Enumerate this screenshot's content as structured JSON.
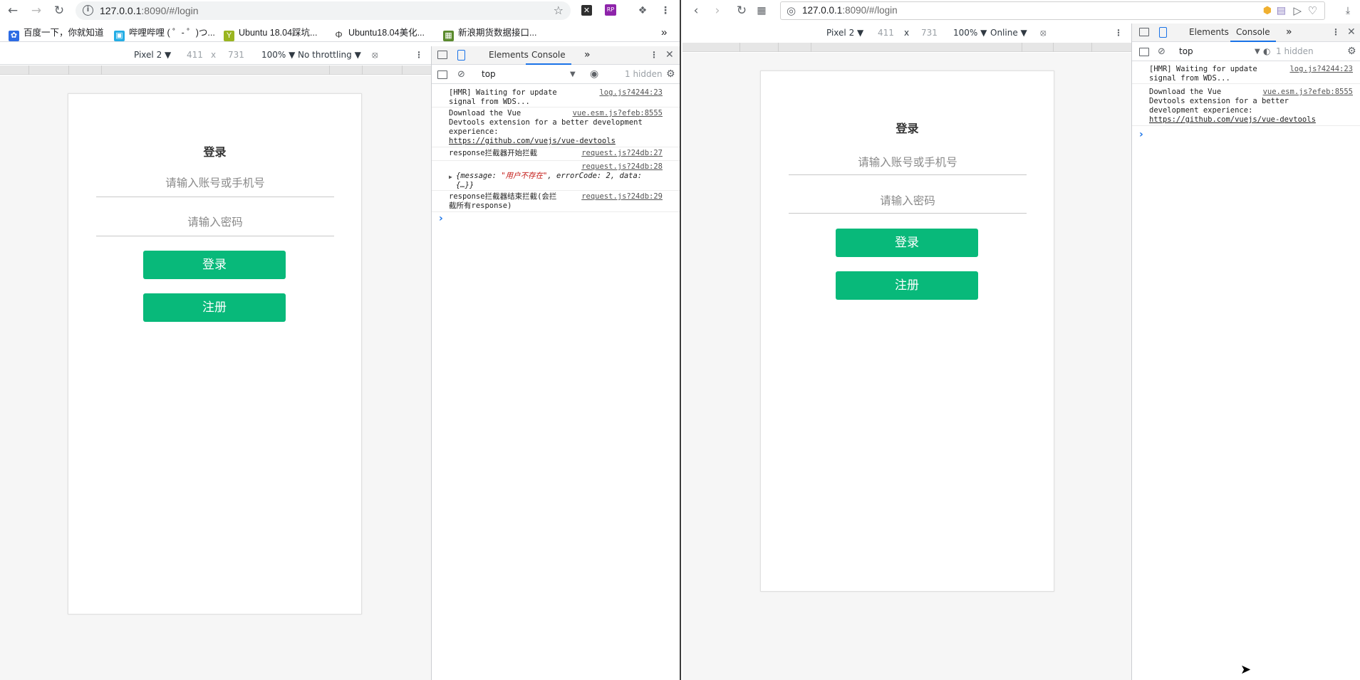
{
  "left_window": {
    "url_host": "127.0.0.1",
    "url_rest": ":8090/#/login",
    "bookmarks": [
      {
        "label": "百度一下，你就知道",
        "icon": "paw-icon"
      },
      {
        "label": "哔哩哔哩 ( ゜- ゜)つ...",
        "icon": "bilibili-icon"
      },
      {
        "label": "Ubuntu 18.04踩坑...",
        "icon": "y-icon"
      },
      {
        "label": "Ubuntu18.04美化...",
        "icon": "leaf-icon"
      },
      {
        "label": "新浪期货数据接口...",
        "icon": "grid-icon"
      }
    ],
    "bookmarks_more": "»",
    "device_toolbar": {
      "device": "Pixel 2 ▼",
      "width": "411",
      "x": "x",
      "height": "731",
      "zoom": "100% ▼",
      "throttle": "No throttling ▼"
    },
    "page": {
      "title": "登录",
      "account_placeholder": "请输入账号或手机号",
      "password_placeholder": "请输入密码",
      "login_button": "登录",
      "register_button": "注册"
    },
    "devtools": {
      "tabs": [
        "Elements",
        "Console"
      ],
      "more": "»",
      "context": "top",
      "hidden": "1 hidden",
      "console": [
        {
          "msg": "[HMR] Waiting for update\nsignal from WDS...",
          "src": "log.js?4244:23"
        },
        {
          "msg": "Download the Vue\nDevtools extension for a better development\nexperience:",
          "link": "https://github.com/vuejs/vue-devtools",
          "src": "vue.esm.js?efeb:8555"
        },
        {
          "msg": "response拦截器开始拦截",
          "src": "request.js?24db:27"
        },
        {
          "obj_prefix": "{message: ",
          "obj_string": "\"用户不存在\"",
          "obj_suffix": ", errorCode: 2, data:\n{…}}",
          "src": "request.js?24db:28"
        },
        {
          "msg": "response拦截器结束拦截(会拦\n截所有response)",
          "src": "request.js?24db:29"
        }
      ],
      "prompt": "›"
    }
  },
  "right_window": {
    "url_host": "127.0.0.1",
    "url_rest": ":8090/#/login",
    "device_toolbar": {
      "device": "Pixel 2 ▼",
      "width": "411",
      "x": "x",
      "height": "731",
      "zoom": "100% ▼",
      "network": "Online ▼"
    },
    "page": {
      "title": "登录",
      "account_placeholder": "请输入账号或手机号",
      "password_placeholder": "请输入密码",
      "login_button": "登录",
      "register_button": "注册"
    },
    "devtools": {
      "tabs": [
        "Elements",
        "Console"
      ],
      "more": "»",
      "context": "top",
      "hidden": "1 hidden",
      "console": [
        {
          "msg": "[HMR] Waiting for update\nsignal from WDS...",
          "src": "log.js?4244:23"
        },
        {
          "msg": "Download the Vue\nDevtools extension for a better\ndevelopment experience:",
          "link": "https://github.com/vuejs/vue-devtools",
          "src": "vue.esm.js?efeb:8555"
        }
      ],
      "prompt": "›"
    }
  },
  "colors": {
    "accent_button": "#08b97a",
    "devtools_active_tab": "#1a73e8"
  }
}
